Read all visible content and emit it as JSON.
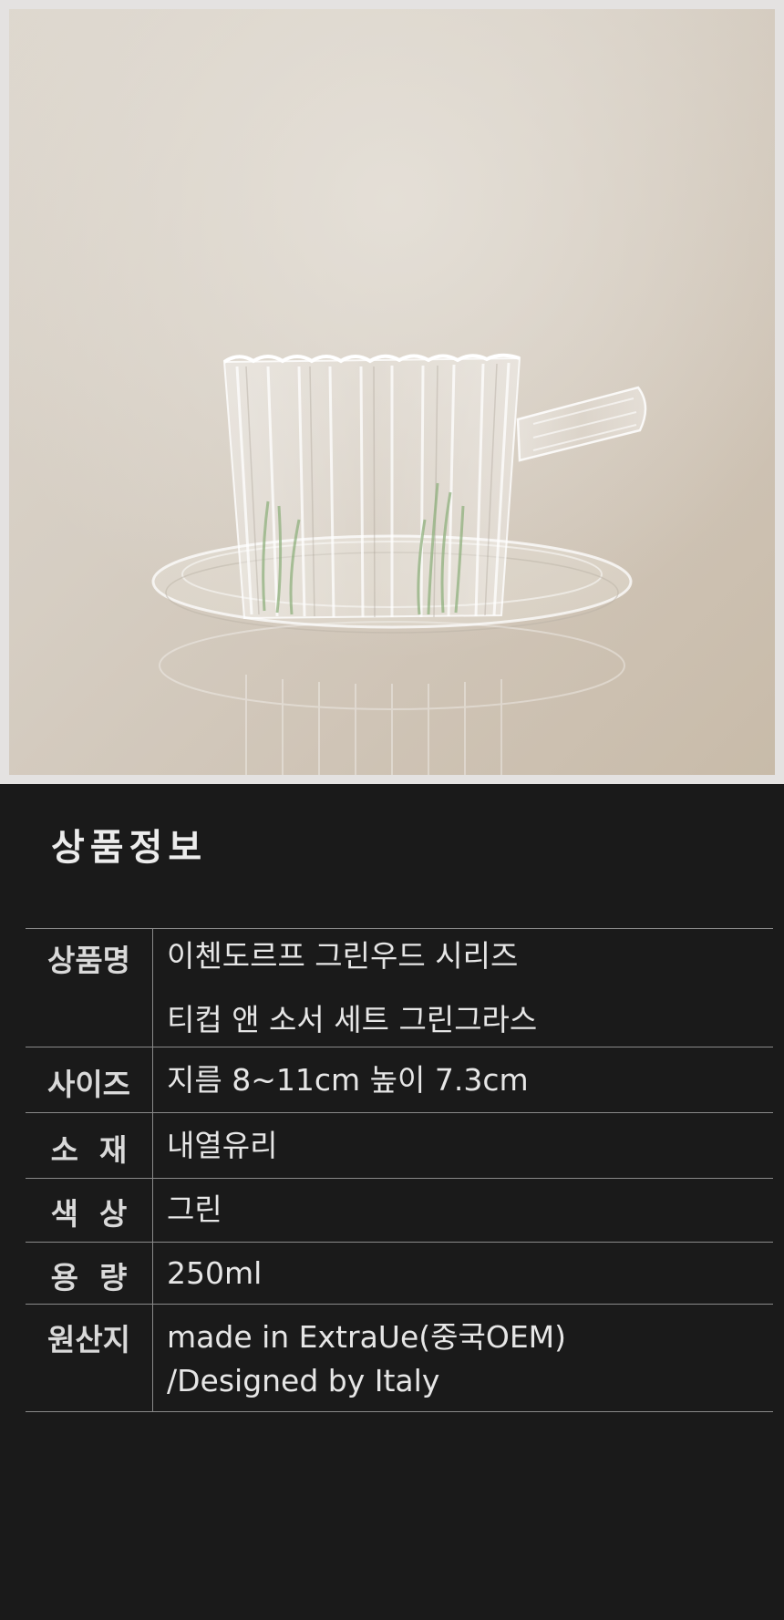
{
  "section_title": "상품정보",
  "spec_rows": [
    {
      "label": "상품명",
      "lines": [
        "이첸도르프 그린우드 시리즈",
        "티컵 앤 소서 세트 그린그라스"
      ]
    },
    {
      "label": "사이즈",
      "lines": [
        "지름 8~11cm 높이 7.3cm"
      ]
    },
    {
      "label": "소  재",
      "lines": [
        "내열유리"
      ]
    },
    {
      "label": "색  상",
      "lines": [
        "그린"
      ]
    },
    {
      "label": "용  량",
      "lines": [
        "250ml"
      ]
    },
    {
      "label": "원산지",
      "lines": [
        "made in ExtraUe(중국OEM)",
        "/Designed by Italy"
      ]
    }
  ],
  "colors": {
    "page_background": "#1a1a1a",
    "photo_frame": "#e4e2e1",
    "photo_background": "#d6cec3",
    "text": "#e6e6e6",
    "rule": "#8a8a8a"
  }
}
